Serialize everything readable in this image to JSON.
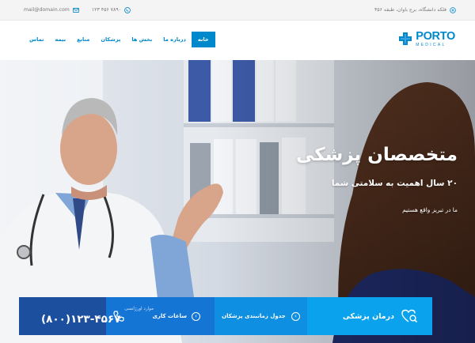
{
  "topbar": {
    "address": "فلکه دانشگاه، برج باوان، طبقه ۴۵۶",
    "phone": "۱۲۳ ۴۵۶ ۷۸۹۰",
    "email": "mail@domain.com"
  },
  "logo": {
    "name": "PORTO",
    "sub": "MEDICAL"
  },
  "nav": [
    {
      "label": "خانه",
      "active": true
    },
    {
      "label": "درباره ما"
    },
    {
      "label": "بخش ها"
    },
    {
      "label": "پزشکان"
    },
    {
      "label": "منابع"
    },
    {
      "label": "بیمه"
    },
    {
      "label": "تماس"
    }
  ],
  "hero": {
    "title": "متخصصان پزشکی",
    "subtitle": "۲۰ سال اهمیت به سلامتی شما",
    "text": "ما در تبریز واقع هستیم"
  },
  "boxes": {
    "emergency_label": "موارد اورژانسی",
    "emergency_phone": "(۸۰۰)۱۲۳-۴۵۶۷",
    "hours_label": "ساعات کاری",
    "schedule_label": "جدول زمانبندی پزشکان",
    "treatment_label": "درمان پزشکی"
  },
  "colors": {
    "primary": "#0088cc",
    "dark_blue": "#1d4f9f",
    "topbar_bg": "#f4f4f4"
  }
}
